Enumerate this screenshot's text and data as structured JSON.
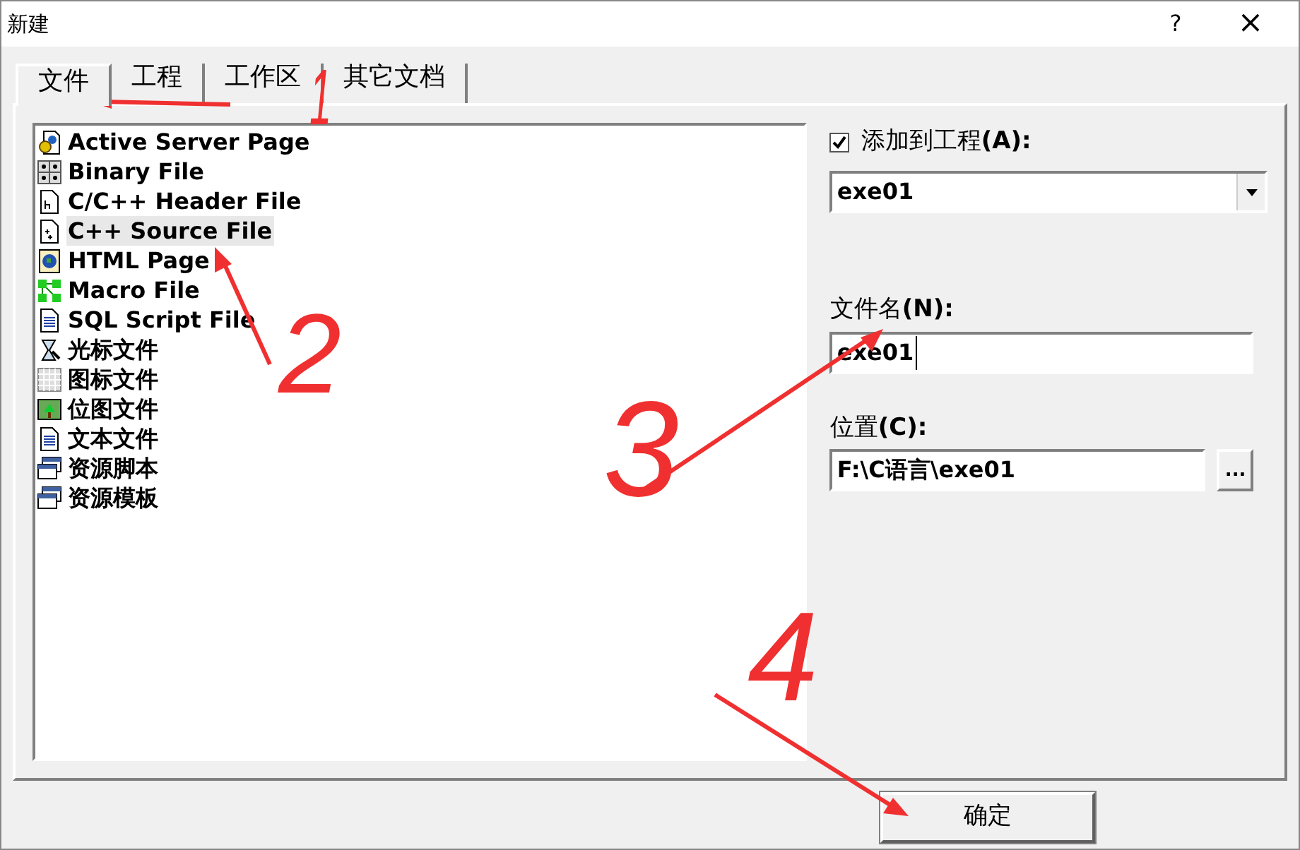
{
  "window": {
    "title": "新建",
    "help": "?",
    "close": "×"
  },
  "tabs": [
    {
      "label": "文件",
      "selected": true
    },
    {
      "label": "工程",
      "selected": false
    },
    {
      "label": "工作区",
      "selected": false
    },
    {
      "label": "其它文档",
      "selected": false
    }
  ],
  "file_types": [
    {
      "name": "Active Server Page",
      "kind": "asp",
      "selected": false
    },
    {
      "name": "Binary File",
      "kind": "binary",
      "selected": false
    },
    {
      "name": "C/C++ Header File",
      "kind": "header",
      "selected": false
    },
    {
      "name": "C++ Source File",
      "kind": "source",
      "selected": true
    },
    {
      "name": "HTML Page",
      "kind": "html",
      "selected": false
    },
    {
      "name": "Macro File",
      "kind": "macro",
      "selected": false
    },
    {
      "name": "SQL Script File",
      "kind": "doc",
      "selected": false
    },
    {
      "name": "光标文件",
      "kind": "cursor",
      "selected": false
    },
    {
      "name": "图标文件",
      "kind": "icon",
      "selected": false
    },
    {
      "name": "位图文件",
      "kind": "bitmap",
      "selected": false
    },
    {
      "name": "文本文件",
      "kind": "doc",
      "selected": false
    },
    {
      "name": "资源脚本",
      "kind": "resource",
      "selected": false
    },
    {
      "name": "资源模板",
      "kind": "resource",
      "selected": false
    }
  ],
  "add_to_project": {
    "label": "添加到工程**(A):**",
    "checked": true,
    "value": "exe01"
  },
  "file_name": {
    "label": "文件名**(N):**",
    "value": "exe01"
  },
  "location": {
    "label": "位置**(C):**",
    "value": "F:\\C语言\\exe01",
    "browse": "..."
  },
  "ok_button": "确定",
  "annotations": [
    {
      "label": "1"
    },
    {
      "label": "2"
    },
    {
      "label": "3"
    },
    {
      "label": "4"
    }
  ]
}
